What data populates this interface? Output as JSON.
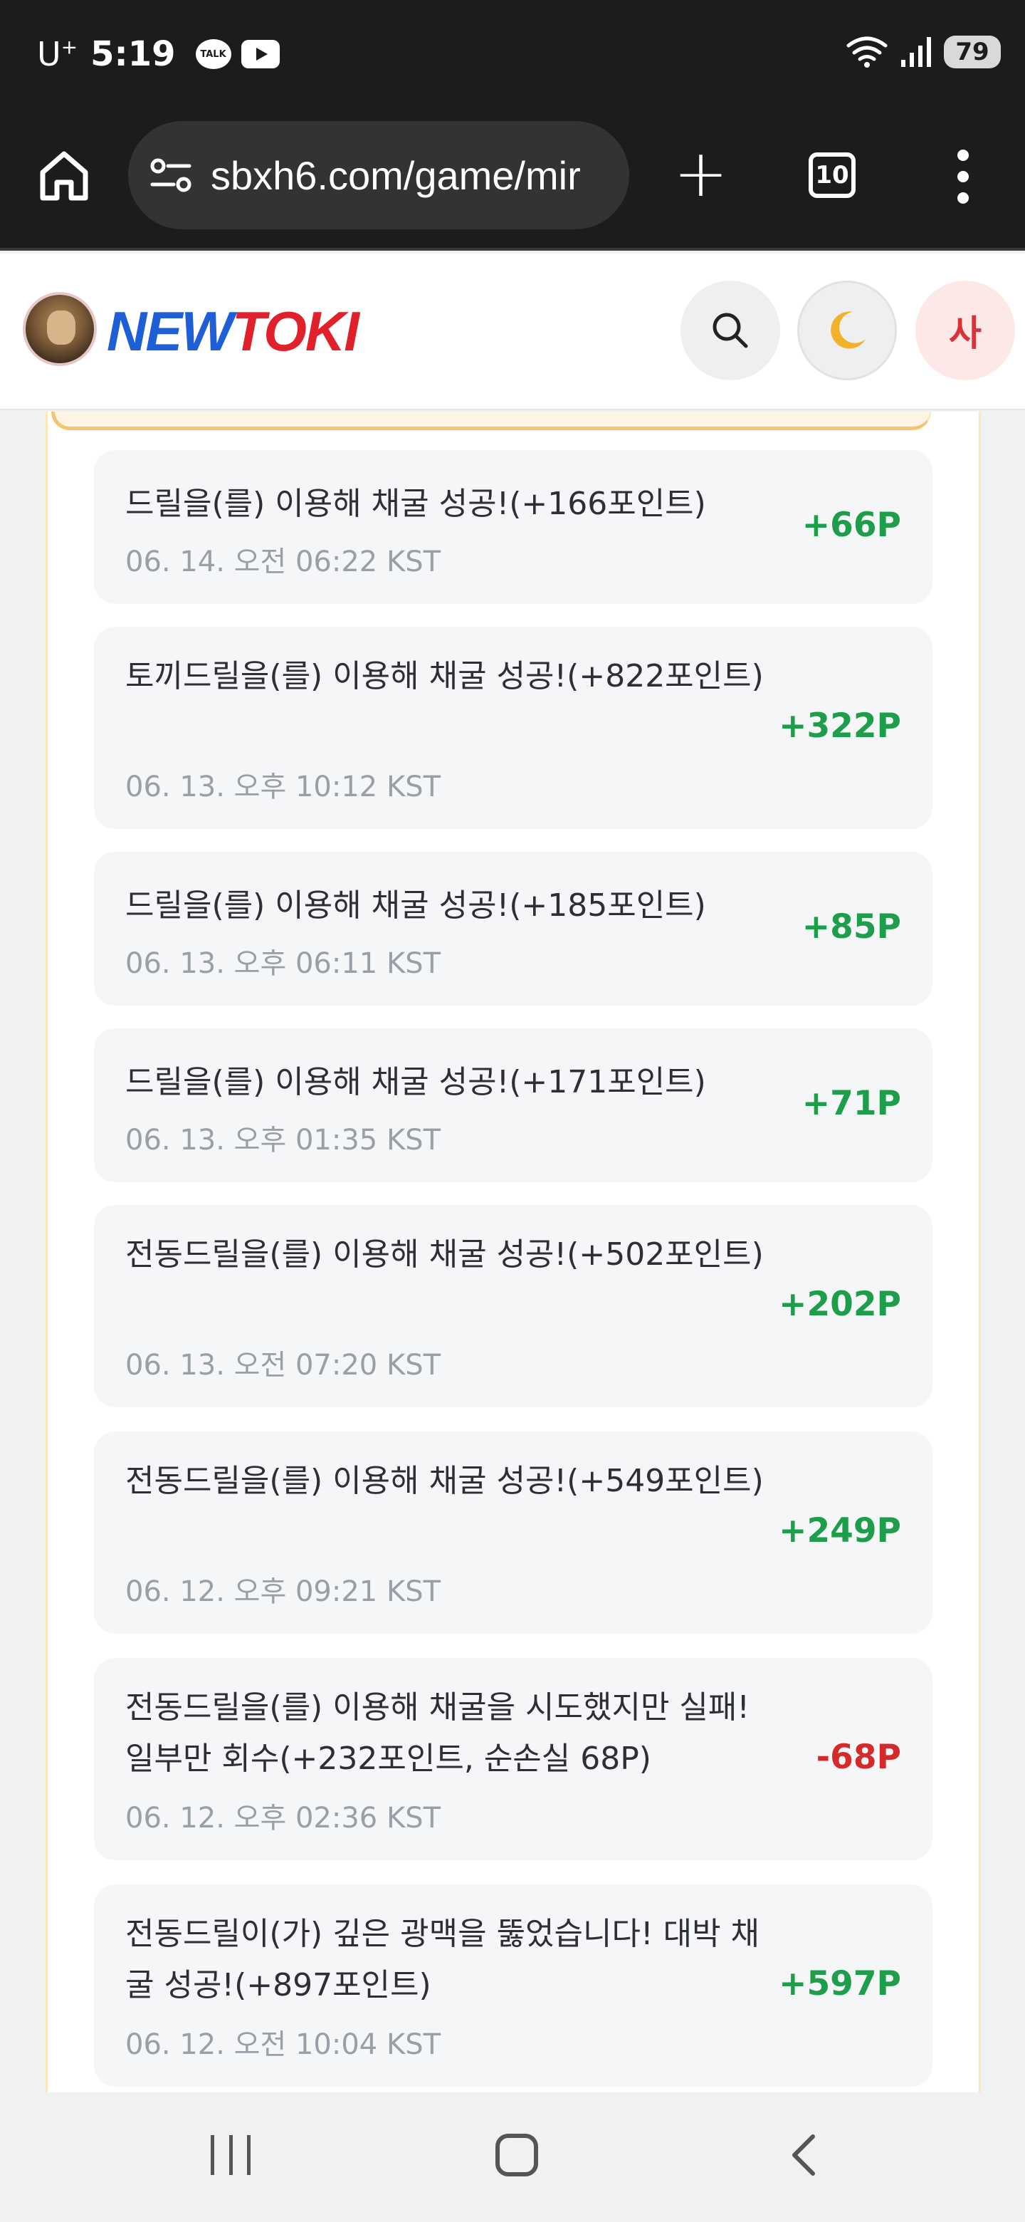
{
  "status_bar": {
    "carrier": "U",
    "carrier_sup": "+",
    "time": "5:19",
    "talk_badge": "TALK",
    "battery": "79"
  },
  "browser": {
    "url": "sbxh6.com/game/mir",
    "tab_count": "10"
  },
  "site": {
    "logo_new": "NEW",
    "logo_toki": "TOKI",
    "user_initial": "사"
  },
  "history": [
    {
      "title": "드릴을(를) 이용해 채굴 성공!(+166포인트)",
      "date": "06. 14. 오전 06:22 KST",
      "points": "+66P",
      "type": "pos"
    },
    {
      "title": "토끼드릴을(를) 이용해 채굴 성공!(+822포인트)",
      "date": "06. 13. 오후 10:12 KST",
      "points": "+322P",
      "type": "pos"
    },
    {
      "title": "드릴을(를) 이용해 채굴 성공!(+185포인트)",
      "date": "06. 13. 오후 06:11 KST",
      "points": "+85P",
      "type": "pos"
    },
    {
      "title": "드릴을(를) 이용해 채굴 성공!(+171포인트)",
      "date": "06. 13. 오후 01:35 KST",
      "points": "+71P",
      "type": "pos"
    },
    {
      "title": "전동드릴을(를) 이용해 채굴 성공!(+502포인트)",
      "date": "06. 13. 오전 07:20 KST",
      "points": "+202P",
      "type": "pos"
    },
    {
      "title": "전동드릴을(를) 이용해 채굴 성공!(+549포인트)",
      "date": "06. 12. 오후 09:21 KST",
      "points": "+249P",
      "type": "pos"
    },
    {
      "title": "전동드릴을(를) 이용해 채굴을 시도했지만 실패! 일부만 회수(+232포인트, 순손실 68P)",
      "date": "06. 12. 오후 02:36 KST",
      "points": "-68P",
      "type": "neg"
    },
    {
      "title": "전동드릴이(가) 깊은 광맥을 뚫었습니다! 대박 채굴 성공!(+897포인트)",
      "date": "06. 12. 오전 10:04 KST",
      "points": "+597P",
      "type": "pos"
    }
  ]
}
